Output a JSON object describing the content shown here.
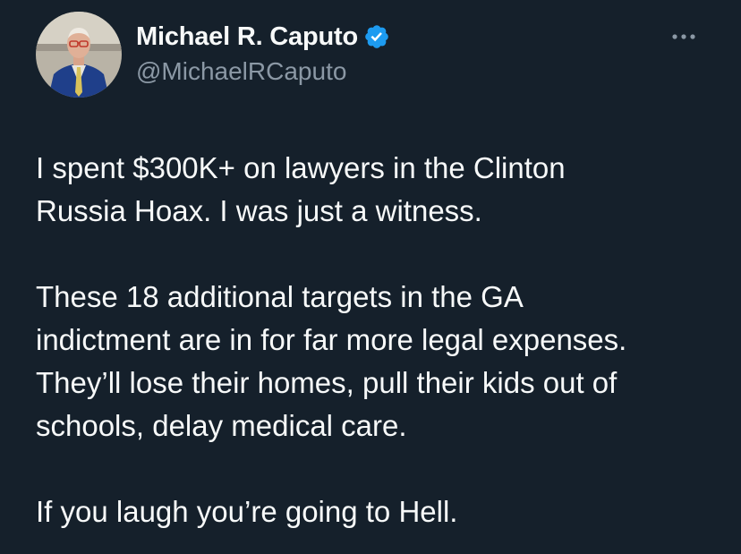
{
  "author": {
    "display_name": "Michael R. Caputo",
    "handle": "@MichaelRCaputo",
    "verified": true,
    "avatar": "profile-photo"
  },
  "more_icon": "more-horizontal-icon",
  "tweet": {
    "paragraphs": [
      "I spent $300K+ on lawyers in the Clinton\nRussia Hoax. I was just a witness.",
      "These 18 additional targets in the GA\nindictment are in for far more legal expenses.\nThey’ll lose their homes, pull their kids out of\nschools, delay medical care.",
      "If you laugh you’re going to Hell."
    ]
  },
  "colors": {
    "background": "#15202b",
    "text_primary": "#f7f9f9",
    "text_secondary": "#8b98a5",
    "verified_blue": "#1d9bf0"
  }
}
